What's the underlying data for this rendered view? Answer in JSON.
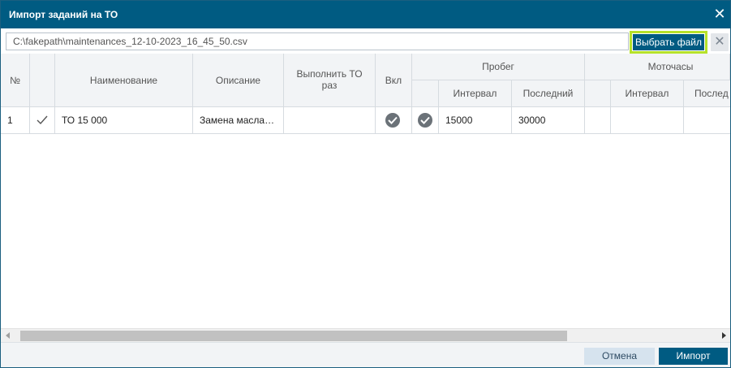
{
  "dialog": {
    "title": "Импорт заданий на ТО",
    "file_path": "C:\\fakepath\\maintenances_12-10-2023_16_45_50.csv",
    "choose_file_label": "Выбрать файл"
  },
  "grid": {
    "headers": {
      "num": "№",
      "name": "Наименование",
      "description": "Описание",
      "perform_times": "Выполнить ТО раз",
      "enabled": "Вкл",
      "mileage_group": "Пробег",
      "mileage_interval": "Интервал",
      "mileage_last": "Последний",
      "hours_group": "Моточасы",
      "hours_interval": "Интервал",
      "hours_last": "Послед"
    },
    "rows": [
      {
        "num": "1",
        "checked": true,
        "name": "ТО 15 000",
        "description": "Замена масла…",
        "perform_times": "",
        "enabled": true,
        "mileage_enabled": true,
        "mileage_interval": "15000",
        "mileage_last": "30000",
        "hours_interval": "",
        "hours_last": ""
      }
    ]
  },
  "footer": {
    "cancel_label": "Отмена",
    "import_label": "Импорт"
  },
  "colors": {
    "primary": "#005b82",
    "highlight": "#b6e22a",
    "header_bg": "#f2f4f6"
  }
}
